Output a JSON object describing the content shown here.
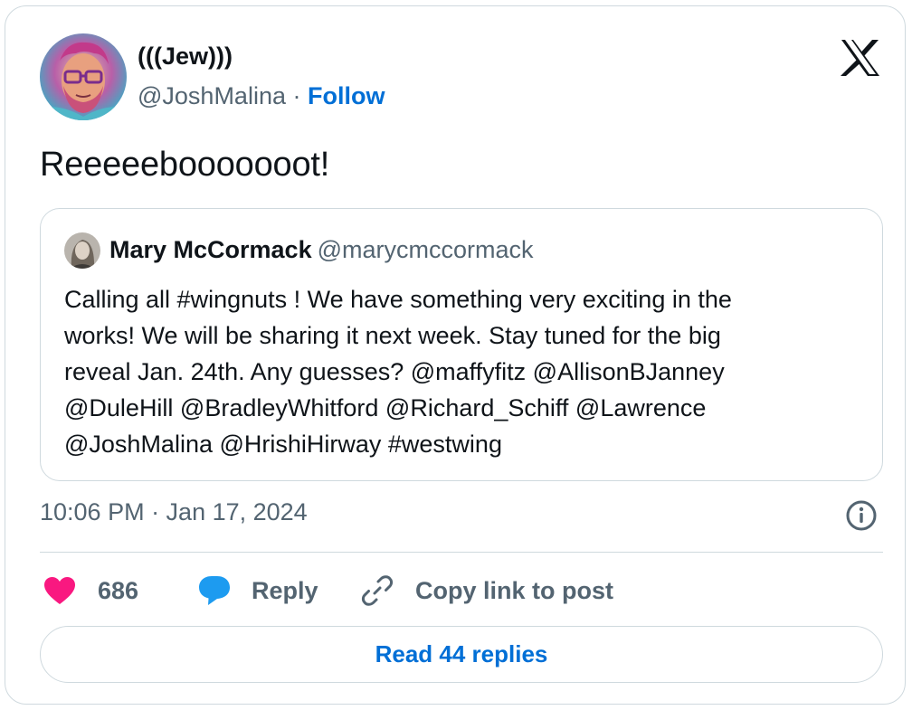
{
  "tweet": {
    "author": {
      "name": "(((Jew)))",
      "handle": "@JoshMalina",
      "separator": "·",
      "follow_label": "Follow",
      "avatar_icon": "profile-avatar"
    },
    "platform_icon": "x-logo-icon",
    "text": "Reeeeebooooooot!",
    "quoted": {
      "name": "Mary McCormack",
      "handle": "@marycmccormack",
      "avatar_icon": "profile-avatar",
      "text_lines": [
        "Calling all #wingnuts ! We have something very exciting in the",
        "works! We will be sharing it next week. Stay tuned for the big",
        "reveal Jan. 24th. Any guesses? @maffyfitz @AllisonBJanney",
        "@DuleHill @BradleyWhitford @Richard_Schiff @Lawrence",
        "@JoshMalina @HrishiHirway #westwing"
      ]
    },
    "timestamp": "10:06 PM · Jan 17, 2024",
    "info_icon": "info-icon",
    "actions": {
      "like_count": "686",
      "reply_label": "Reply",
      "copy_link_label": "Copy link to post"
    },
    "read_replies_label": "Read 44 replies"
  },
  "colors": {
    "link_blue": "#006fd6",
    "like_pink": "#f91880",
    "reply_blue": "#1d9bf0",
    "secondary_text": "#536471",
    "border": "#cfd9de"
  }
}
